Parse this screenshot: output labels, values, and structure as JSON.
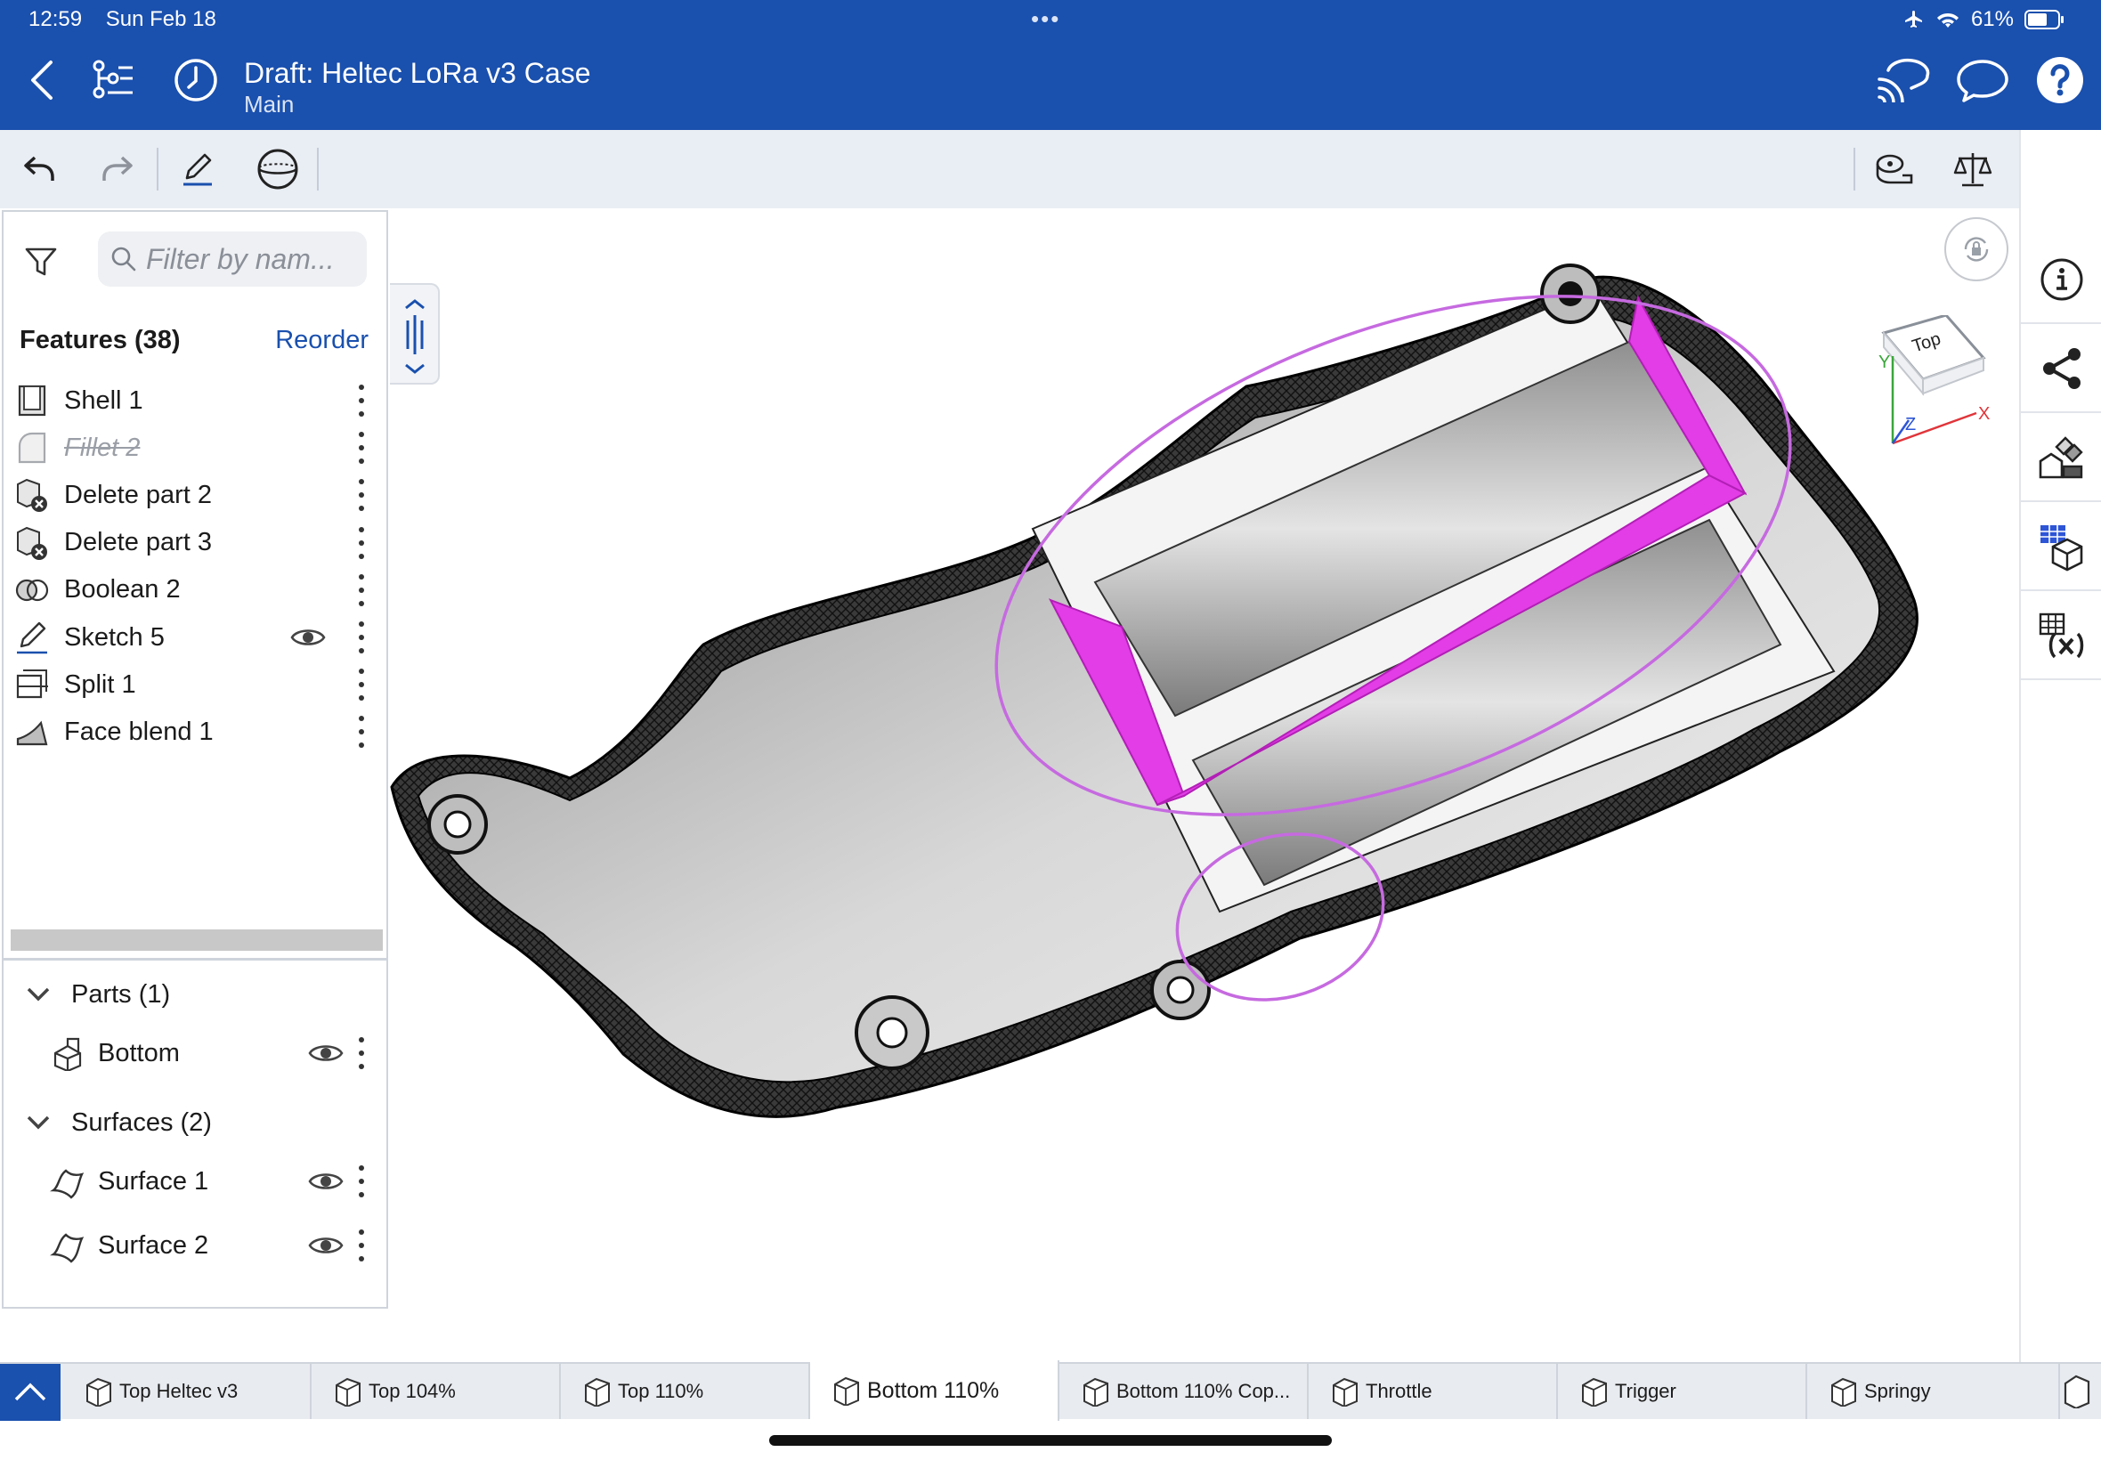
{
  "status_bar": {
    "time": "12:59",
    "date": "Sun Feb 18",
    "battery": "61%",
    "icons": [
      "airplane-icon",
      "wifi-icon",
      "battery-icon"
    ]
  },
  "header": {
    "title": "Draft: Heltec LoRa v3 Case",
    "subtitle": "Main"
  },
  "panel": {
    "filter_placeholder": "Filter by nam...",
    "features_heading": "Features (38)",
    "reorder_label": "Reorder",
    "features": [
      {
        "label": "Shell 1",
        "icon": "shell-icon",
        "suppressed": false,
        "visible_toggle": false
      },
      {
        "label": "Fillet 2",
        "icon": "fillet-icon",
        "suppressed": true,
        "visible_toggle": false
      },
      {
        "label": "Delete part 2",
        "icon": "delete-part-icon",
        "suppressed": false,
        "visible_toggle": false
      },
      {
        "label": "Delete part 3",
        "icon": "delete-part-icon",
        "suppressed": false,
        "visible_toggle": false
      },
      {
        "label": "Boolean 2",
        "icon": "boolean-icon",
        "suppressed": false,
        "visible_toggle": false
      },
      {
        "label": "Sketch 5",
        "icon": "sketch-icon",
        "suppressed": false,
        "visible_toggle": true
      },
      {
        "label": "Split 1",
        "icon": "split-icon",
        "suppressed": false,
        "visible_toggle": false
      },
      {
        "label": "Face blend 1",
        "icon": "face-blend-icon",
        "suppressed": false,
        "visible_toggle": false
      }
    ],
    "parts_heading": "Parts (1)",
    "parts": [
      {
        "label": "Bottom"
      }
    ],
    "surfaces_heading": "Surfaces (2)",
    "surfaces": [
      {
        "label": "Surface 1"
      },
      {
        "label": "Surface 2"
      }
    ]
  },
  "view_cube": {
    "face_label": "Top",
    "axes": [
      "X",
      "Y",
      "Z"
    ]
  },
  "tabs": [
    {
      "label": "Top Heltec v3",
      "active": false
    },
    {
      "label": "Top 104%",
      "active": false
    },
    {
      "label": "Top 110%",
      "active": false
    },
    {
      "label": "Bottom 110%",
      "active": true
    },
    {
      "label": "Bottom 110% Cop...",
      "active": false
    },
    {
      "label": "Throttle",
      "active": false
    },
    {
      "label": "Trigger",
      "active": false
    },
    {
      "label": "Springy",
      "active": false
    }
  ],
  "colors": {
    "header_blue": "#1a50ae",
    "selection_magenta": "#e23de6",
    "annotation_purple": "#c66ae0"
  }
}
